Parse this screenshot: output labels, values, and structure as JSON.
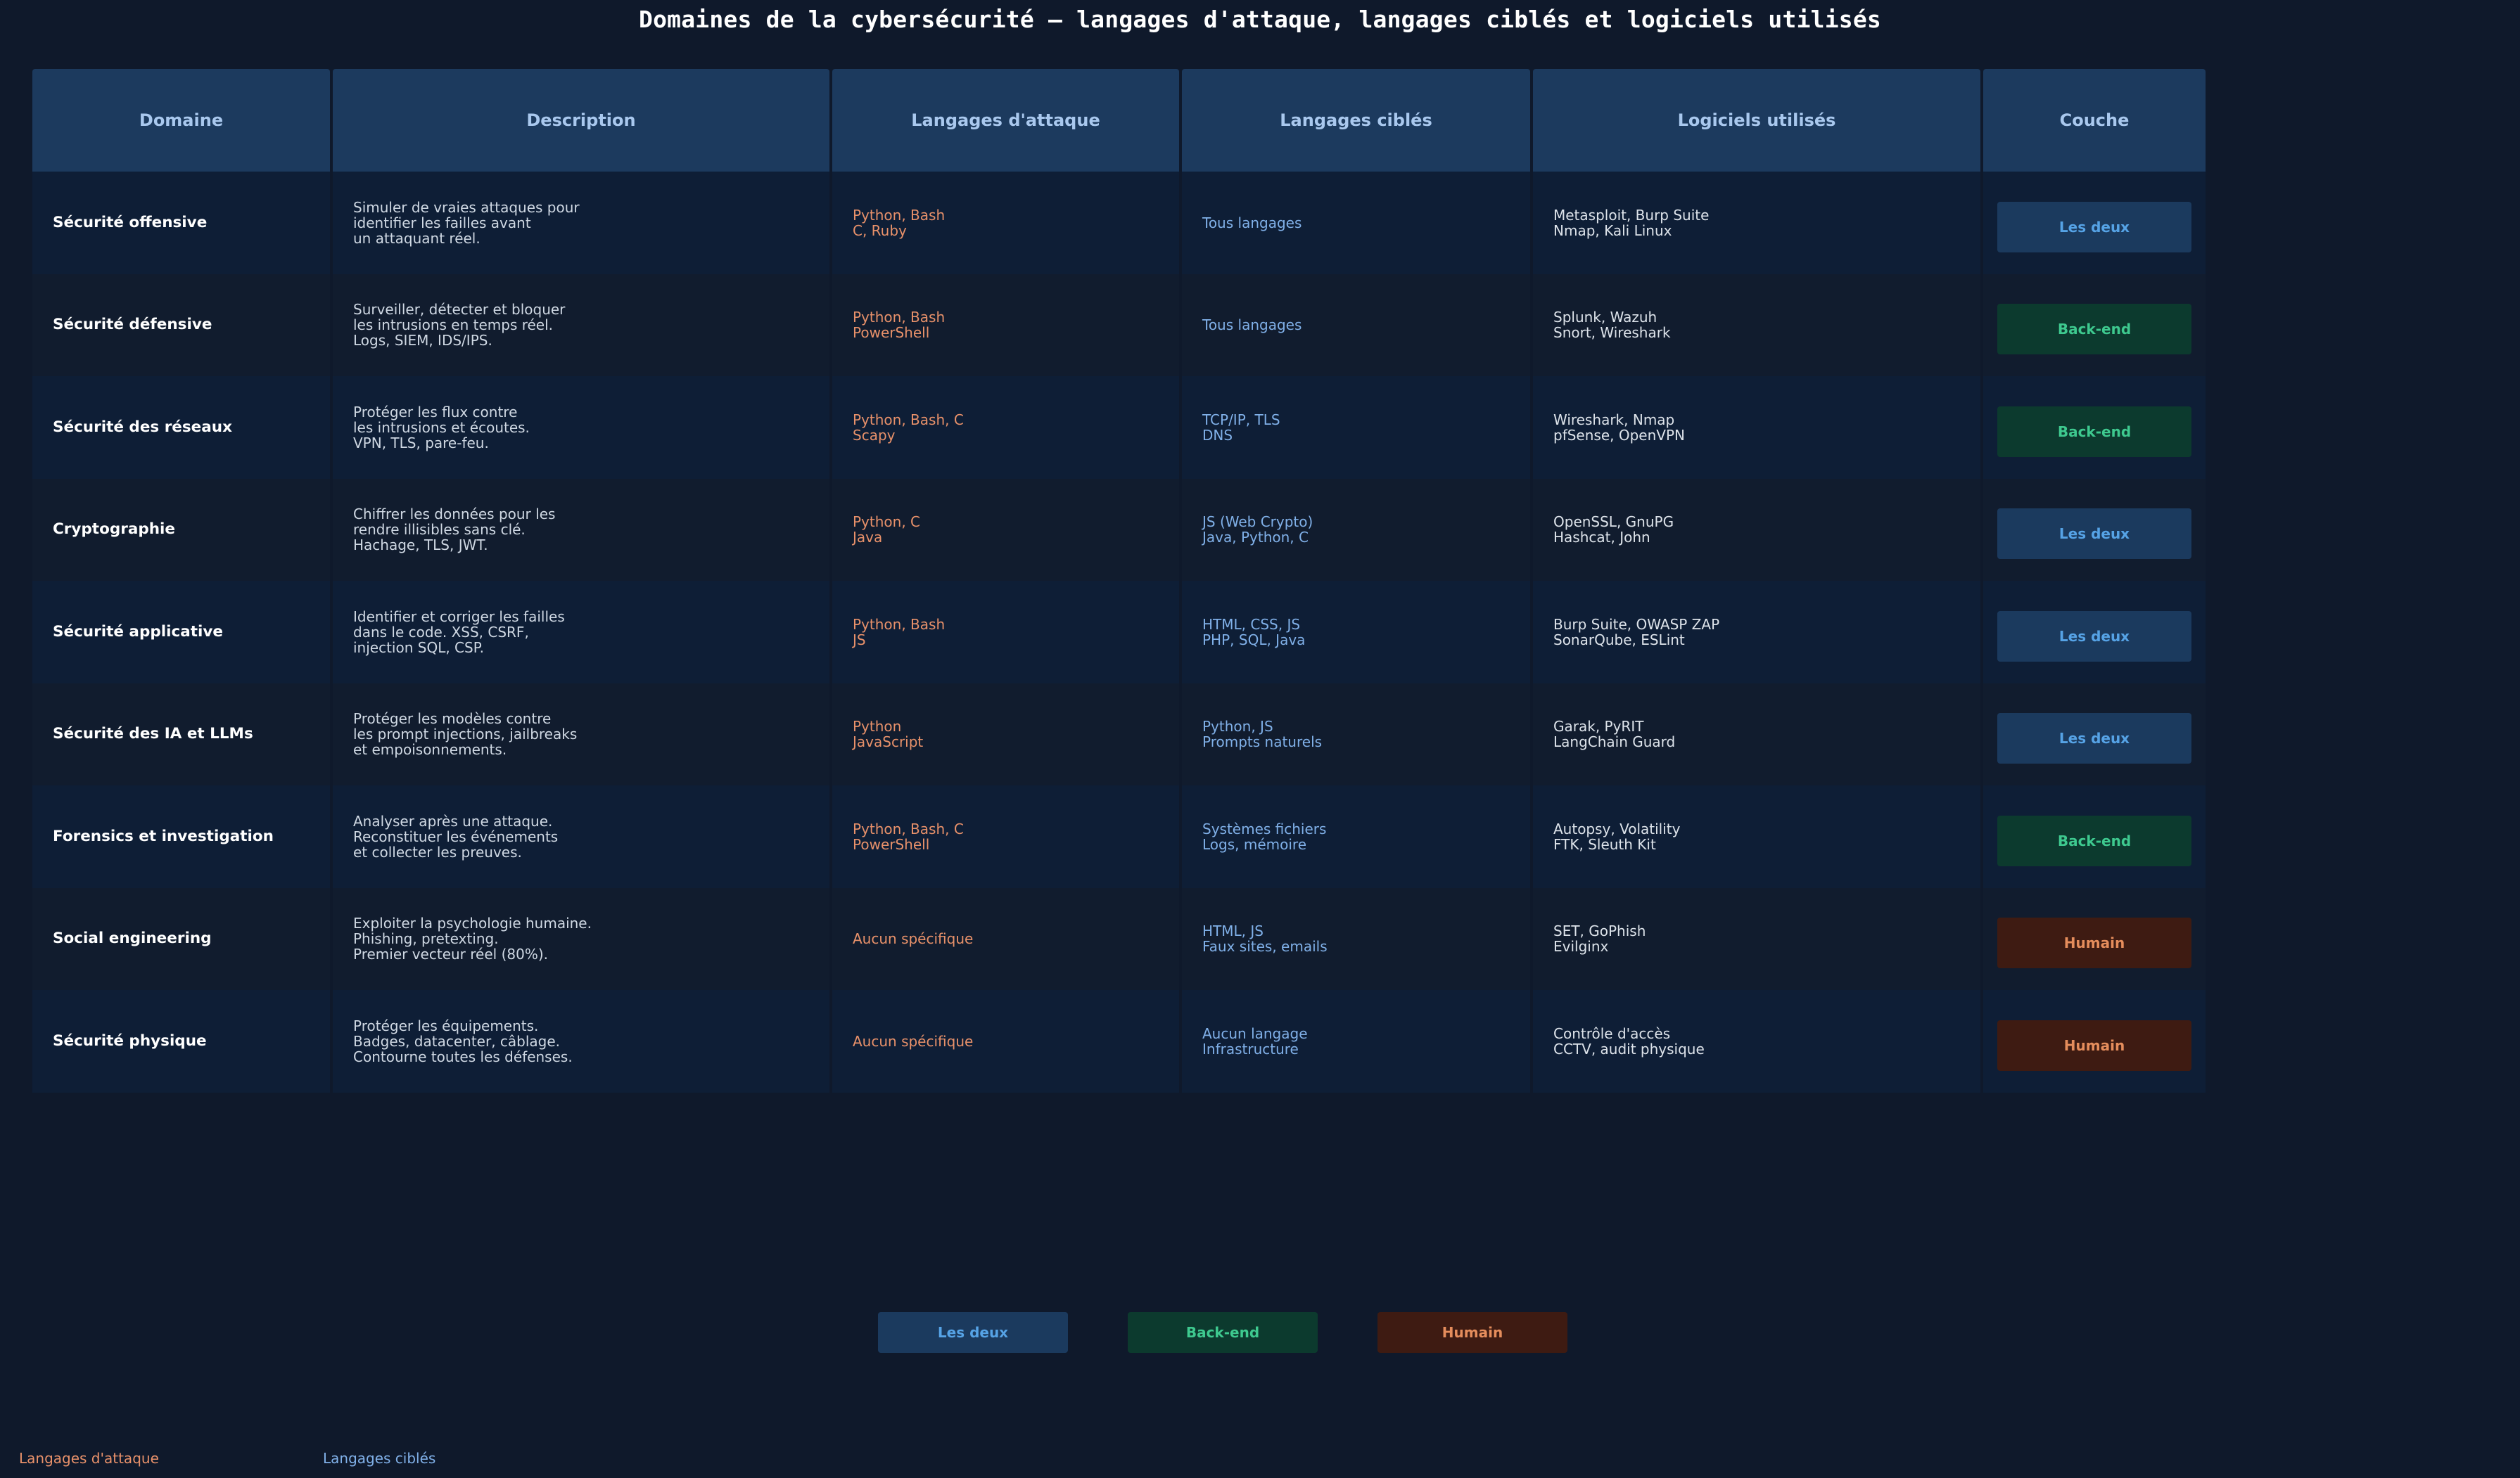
{
  "title": "Domaines de la cybersécurité — langages d'attaque, langages ciblés et logiciels utilisés",
  "headers": [
    "Domaine",
    "Description",
    "Langages d'attaque",
    "Langages ciblés",
    "Logiciels utilisés",
    "Couche"
  ],
  "rows": [
    {
      "domain": "Sécurité offensive",
      "description": "Simuler de vraies attaques pour\nidentifier les failles avant\nun attaquant réel.",
      "attack": "Python, Bash\nC, Ruby",
      "targets": "Tous langages",
      "tools": "Metasploit, Burp Suite\nNmap, Kali Linux",
      "layer": "Les deux"
    },
    {
      "domain": "Sécurité défensive",
      "description": "Surveiller, détecter et bloquer\nles intrusions en temps réel.\nLogs, SIEM, IDS/IPS.",
      "attack": "Python, Bash\nPowerShell",
      "targets": "Tous langages",
      "tools": "Splunk, Wazuh\nSnort, Wireshark",
      "layer": "Back-end"
    },
    {
      "domain": "Sécurité des réseaux",
      "description": "Protéger les flux contre\nles intrusions et écoutes.\nVPN, TLS, pare-feu.",
      "attack": "Python, Bash, C\nScapy",
      "targets": "TCP/IP, TLS\nDNS",
      "tools": "Wireshark, Nmap\npfSense, OpenVPN",
      "layer": "Back-end"
    },
    {
      "domain": "Cryptographie",
      "description": "Chiffrer les données pour les\nrendre illisibles sans clé.\nHachage, TLS, JWT.",
      "attack": "Python, C\nJava",
      "targets": "JS (Web Crypto)\nJava, Python, C",
      "tools": "OpenSSL, GnuPG\nHashcat, John",
      "layer": "Les deux"
    },
    {
      "domain": "Sécurité applicative",
      "description": "Identifier et corriger les failles\ndans le code. XSS, CSRF,\ninjection SQL, CSP.",
      "attack": "Python, Bash\nJS",
      "targets": "HTML, CSS, JS\nPHP, SQL, Java",
      "tools": "Burp Suite, OWASP ZAP\nSonarQube, ESLint",
      "layer": "Les deux"
    },
    {
      "domain": "Sécurité des IA et LLMs",
      "description": "Protéger les modèles contre\nles prompt injections, jailbreaks\net empoisonnements.",
      "attack": "Python\nJavaScript",
      "targets": "Python, JS\nPrompts naturels",
      "tools": "Garak, PyRIT\nLangChain Guard",
      "layer": "Les deux"
    },
    {
      "domain": "Forensics et investigation",
      "description": "Analyser après une attaque.\nReconstituer les événements\net collecter les preuves.",
      "attack": "Python, Bash, C\nPowerShell",
      "targets": "Systèmes fichiers\nLogs, mémoire",
      "tools": "Autopsy, Volatility\nFTK, Sleuth Kit",
      "layer": "Back-end"
    },
    {
      "domain": "Social engineering",
      "description": "Exploiter la psychologie humaine.\nPhishing, pretexting.\nPremier vecteur réel (80%).",
      "attack": "Aucun spécifique",
      "targets": "HTML, JS\nFaux sites, emails",
      "tools": "SET, GoPhish\nEvilginx",
      "layer": "Humain"
    },
    {
      "domain": "Sécurité physique",
      "description": "Protéger les équipements.\nBadges, datacenter, câblage.\nContourne toutes les défenses.",
      "attack": "Aucun spécifique",
      "targets": "Aucun langage\nInfrastructure",
      "tools": "Contrôle d'accès\nCCTV, audit physique",
      "layer": "Humain"
    }
  ],
  "legend": [
    "Les deux",
    "Back-end",
    "Humain"
  ],
  "footer": {
    "attack_label": "Langages d'attaque",
    "target_label": "Langages ciblés"
  },
  "colors": {
    "background": "#0f192b",
    "header": "#1c3a5e",
    "attack_text": "#e8916a",
    "target_text": "#80b0e8",
    "both_badge": "#1b3a5e",
    "backend_badge": "#0c3a2e",
    "human_badge": "#3e1b12"
  }
}
